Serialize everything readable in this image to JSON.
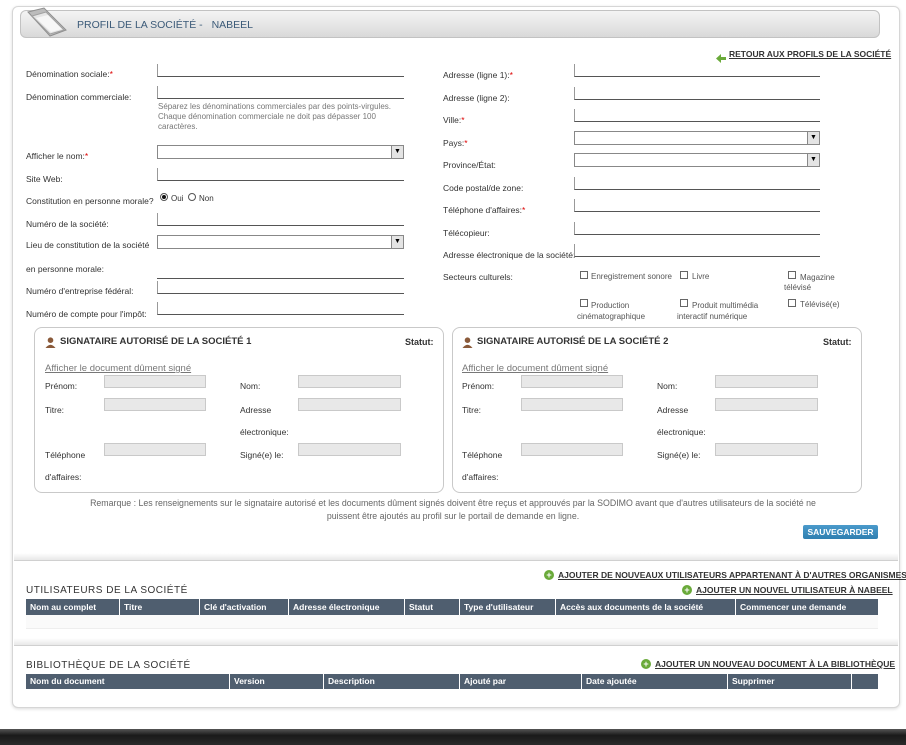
{
  "header": {
    "title": "PROFIL DE LA SOCIÉTÉ -",
    "company": "NABEEL"
  },
  "back_link": "RETOUR AUX PROFILS DE LA SOCIÉTÉ",
  "left_form": {
    "denomination_sociale": "Dénomination sociale:",
    "denomination_commerciale": "Dénomination commerciale:",
    "hint_line1": "Séparez les dénominations commerciales par des points-virgules.",
    "hint_line2": "Chaque dénomination commerciale ne doit pas dépasser 100",
    "hint_line3": "caractères.",
    "afficher_nom": "Afficher le nom:",
    "site_web": "Site Web:",
    "constitution": "Constitution en personne morale?",
    "oui": "Oui",
    "non": "Non",
    "numero_societe": "Numéro de la société:",
    "lieu_line1": "Lieu de constitution de la société",
    "lieu_line2": "en personne morale:",
    "numero_federal": "Numéro d'entreprise fédéral:",
    "numero_impot": "Numéro de compte pour l'impôt:"
  },
  "right_form": {
    "adresse1": "Adresse (ligne 1):",
    "adresse2": "Adresse (ligne 2):",
    "ville": "Ville:",
    "pays": "Pays:",
    "province": "Province/État:",
    "code_postal": "Code postal/de zone:",
    "telephone": "Téléphone d'affaires:",
    "telecopieur": "Télécopieur:",
    "adresse_electronique": "Adresse électronique de la société:",
    "secteurs": "Secteurs culturels:",
    "sectors": {
      "enregistrement": "Enregistrement sonore",
      "livre": "Livre",
      "magazine_l1": "Magazine",
      "magazine_l2": "télévisé",
      "production_l1": "Production",
      "production_l2": "cinématographique",
      "produit_l1": "Produit multimédia",
      "produit_l2": "interactif numérique",
      "televise": "Télévisé(e)"
    }
  },
  "required_mark": "*",
  "signatory1": {
    "title": "SIGNATAIRE AUTORISÉ DE LA SOCIÉTÉ 1",
    "statut": "Statut:",
    "doc_link": "Afficher le document dûment signé",
    "prenom": "Prénom:",
    "nom": "Nom:",
    "titre": "Titre:",
    "adresse_l1": "Adresse",
    "adresse_l2": "électronique:",
    "telephone_l1": "Téléphone",
    "telephone_l2": "d'affaires:",
    "signe": "Signé(e) le:"
  },
  "signatory2": {
    "title": "SIGNATAIRE AUTORISÉ DE LA SOCIÉTÉ 2",
    "statut": "Statut:",
    "doc_link": "Afficher le document dûment signé",
    "prenom": "Prénom:",
    "nom": "Nom:",
    "titre": "Titre:",
    "adresse_l1": "Adresse",
    "adresse_l2": "électronique:",
    "telephone_l1": "Téléphone",
    "telephone_l2": "d'affaires:",
    "signe": "Signé(e) le:"
  },
  "remark_line1": "Remarque : Les renseignements sur le signataire autorisé et les documents dûment signés doivent être reçus et approuvés par la SODIMO avant que d'autres utilisateurs de la société ne",
  "remark_line2": "puissent être ajoutés au profil sur le portail de demande en ligne.",
  "save_button": "SAUVEGARDER",
  "users": {
    "title": "UTILISATEURS DE LA SOCIÉTÉ",
    "add_other_org": "AJOUTER DE NOUVEAUX UTILISATEURS APPARTENANT À D'AUTRES ORGANISMES",
    "add_user": "AJOUTER UN NOUVEL UTILISATEUR À NABEEL",
    "columns": [
      "Nom au complet",
      "Titre",
      "Clé d'activation",
      "Adresse électronique",
      "Statut",
      "Type d'utilisateur",
      "Accès aux documents de la société",
      "Commencer une demande"
    ]
  },
  "library": {
    "title": "BIBLIOTHÈQUE DE LA SOCIÉTÉ",
    "add_doc": "AJOUTER UN NOUVEAU DOCUMENT À LA BIBLIOTHÈQUE",
    "columns": [
      "Nom du document",
      "Version",
      "Description",
      "Ajouté par",
      "Date ajoutée",
      "Supprimer"
    ]
  },
  "colors": {
    "table_header": "#4f5e6f",
    "button": "#2f7fb0",
    "accent_link": "#6aaa3a",
    "header_text": "#3b5a78"
  }
}
